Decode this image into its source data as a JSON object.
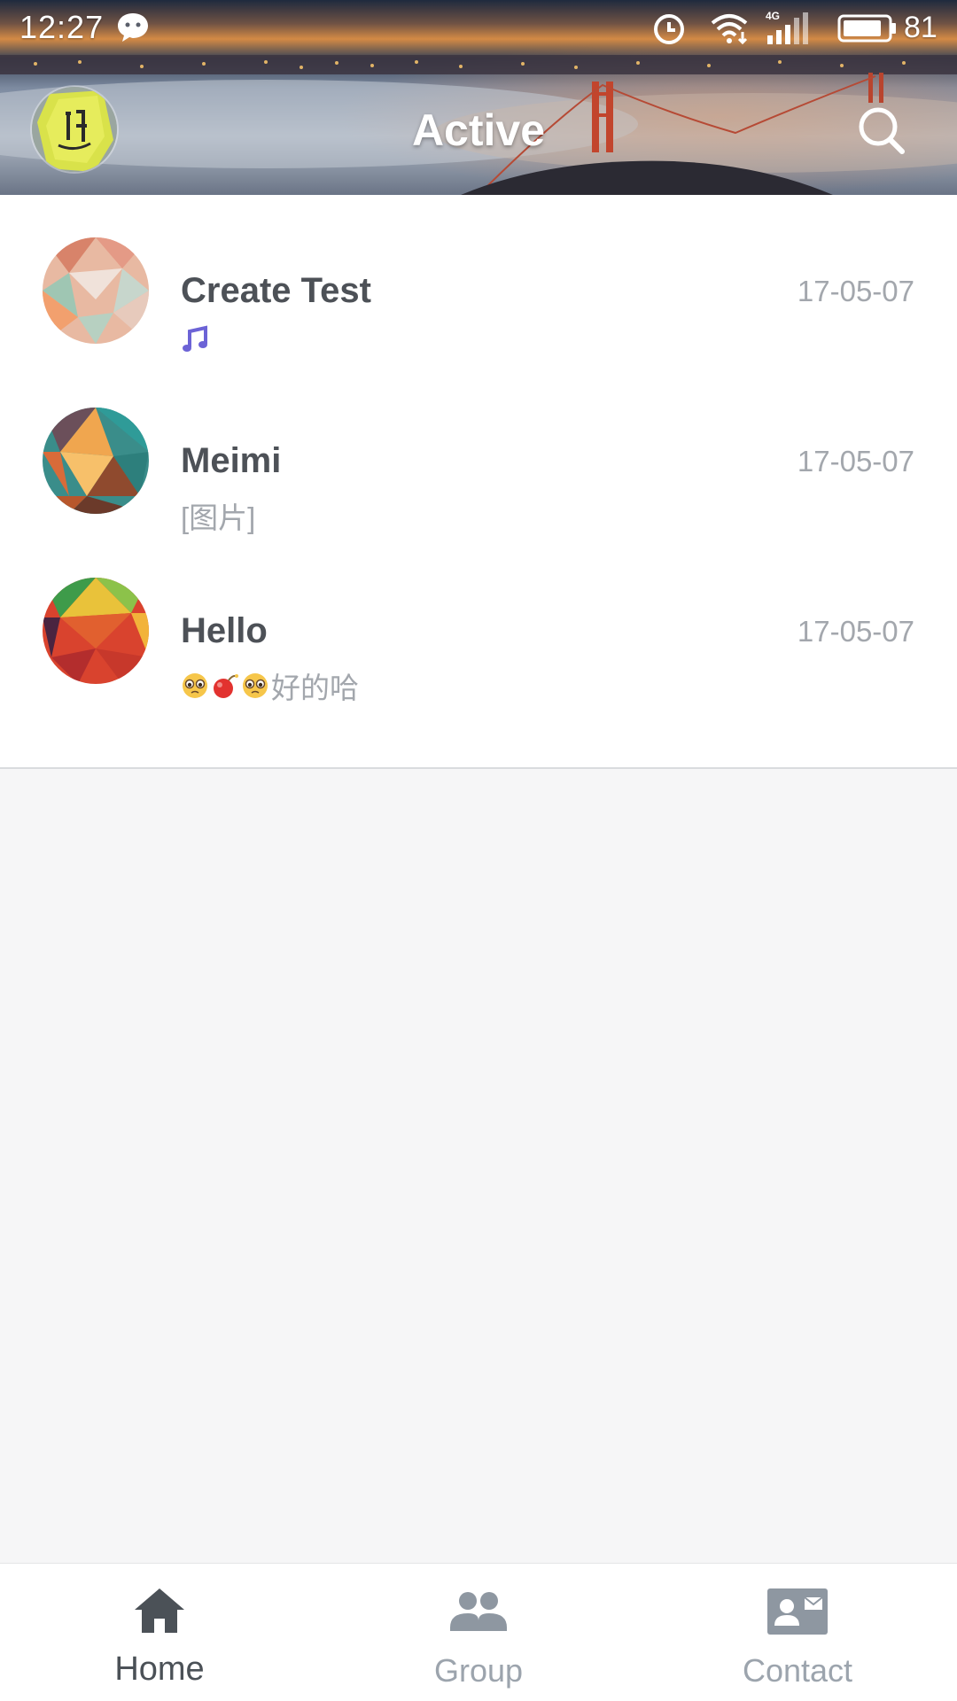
{
  "status_bar": {
    "time": "12:27",
    "battery": "81",
    "network": "4G",
    "icons": [
      "chat-bubble-icon",
      "alarm-icon",
      "wifi-icon",
      "signal-icon",
      "battery-icon"
    ]
  },
  "header": {
    "title": "Active",
    "avatar_icon": "profile-avatar",
    "search_icon": "search-icon"
  },
  "conversations": [
    {
      "name": "Create Test",
      "date": "17-05-07",
      "preview": "",
      "preview_icons": [
        "music-note-icon"
      ]
    },
    {
      "name": "Meimi",
      "date": "17-05-07",
      "preview": "[图片]",
      "preview_icons": []
    },
    {
      "name": "Hello",
      "date": "17-05-07",
      "preview": "好的哈",
      "preview_icons": [
        "pleading-face-emoji",
        "bomb-emoji",
        "pleading-face-emoji"
      ]
    }
  ],
  "bottom_nav": [
    {
      "label": "Home",
      "icon": "home-icon",
      "active": true
    },
    {
      "label": "Group",
      "icon": "group-icon",
      "active": false
    },
    {
      "label": "Contact",
      "icon": "contact-card-icon",
      "active": false
    }
  ],
  "colors": {
    "list_background": "#ffffff",
    "page_background": "#f6f6f7",
    "name_text": "#4d5157",
    "secondary_text": "#a3a7ad",
    "nav_active": "#4b5157",
    "nav_inactive": "#9ca4ad",
    "music_icon": "#6c63d6"
  }
}
